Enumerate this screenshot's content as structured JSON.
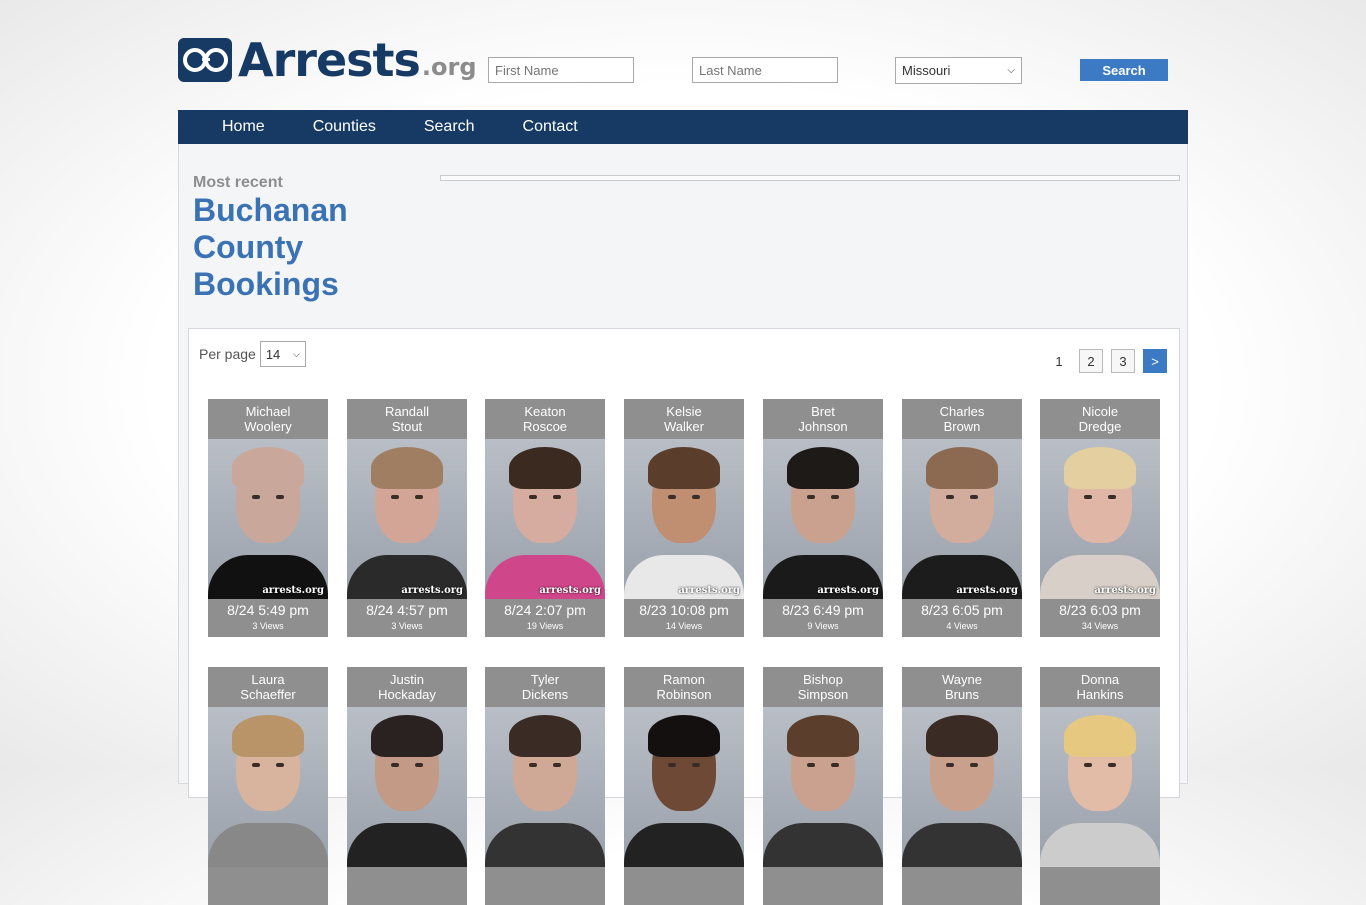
{
  "site": {
    "logo_main": "Arrests",
    "logo_suffix": ".org"
  },
  "header": {
    "first_name_placeholder": "First Name",
    "last_name_placeholder": "Last Name",
    "state_selected": "Missouri",
    "search_label": "Search"
  },
  "nav": {
    "items": [
      "Home",
      "Counties",
      "Search",
      "Contact"
    ]
  },
  "page": {
    "kicker": "Most recent",
    "title_lines": [
      "Buchanan",
      "County",
      "Bookings"
    ]
  },
  "listing": {
    "per_page_label": "Per page",
    "per_page_value": "14",
    "pages": [
      "1",
      "2",
      "3",
      ">"
    ],
    "watermark": "arrests.org",
    "row1": [
      {
        "first": "Michael",
        "last": "Woolery",
        "date": "8/24 5:49 pm",
        "views": "3 Views",
        "skin": "#c9a79a",
        "hair": "#c9a79a",
        "shirt": "#111111"
      },
      {
        "first": "Randall",
        "last": "Stout",
        "date": "8/24 4:57 pm",
        "views": "3 Views",
        "skin": "#d3a596",
        "hair": "#a07e62",
        "shirt": "#2a2a2a"
      },
      {
        "first": "Keaton",
        "last": "Roscoe",
        "date": "8/24 2:07 pm",
        "views": "19 Views",
        "skin": "#d6aba0",
        "hair": "#3b2a20",
        "shirt": "#d0468a"
      },
      {
        "first": "Kelsie",
        "last": "Walker",
        "date": "8/23 10:08 pm",
        "views": "14 Views",
        "skin": "#c08f72",
        "hair": "#5a3e2b",
        "shirt": "#e8e8e8"
      },
      {
        "first": "Bret",
        "last": "Johnson",
        "date": "8/23 6:49 pm",
        "views": "9 Views",
        "skin": "#caa08e",
        "hair": "#1e1a18",
        "shirt": "#1a1a1a"
      },
      {
        "first": "Charles",
        "last": "Brown",
        "date": "8/23 6:05 pm",
        "views": "4 Views",
        "skin": "#d2ac9c",
        "hair": "#8c6a52",
        "shirt": "#1c1c1c"
      },
      {
        "first": "Nicole",
        "last": "Dredge",
        "date": "8/23 6:03 pm",
        "views": "34 Views",
        "skin": "#e0b6a6",
        "hair": "#e3cfa0",
        "shirt": "#d8d0c8"
      }
    ],
    "row2": [
      {
        "first": "Laura",
        "last": "Schaeffer",
        "skin": "#d8b49e",
        "hair": "#b89468",
        "shirt": "#888888"
      },
      {
        "first": "Justin",
        "last": "Hockaday",
        "skin": "#c29a86",
        "hair": "#2a2220",
        "shirt": "#222222"
      },
      {
        "first": "Tyler",
        "last": "Dickens",
        "skin": "#cfa896",
        "hair": "#3a2c24",
        "shirt": "#333333"
      },
      {
        "first": "Ramon",
        "last": "Robinson",
        "skin": "#6e4a36",
        "hair": "#141010",
        "shirt": "#222222"
      },
      {
        "first": "Bishop",
        "last": "Simpson",
        "skin": "#caa08e",
        "hair": "#5c3e2c",
        "shirt": "#333333"
      },
      {
        "first": "Wayne",
        "last": "Bruns",
        "skin": "#c9a08c",
        "hair": "#3a2c24",
        "shirt": "#333333"
      },
      {
        "first": "Donna",
        "last": "Hankins",
        "skin": "#e2bca6",
        "hair": "#e6c880",
        "shirt": "#cccccc"
      }
    ]
  }
}
